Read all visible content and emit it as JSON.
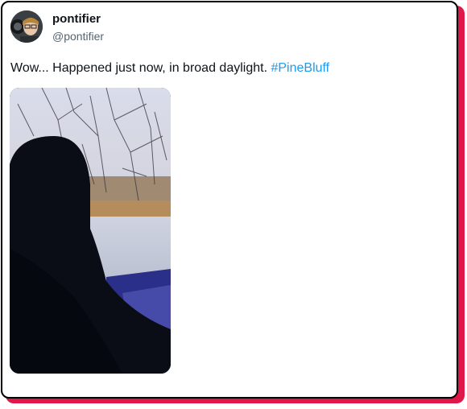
{
  "tweet": {
    "author": {
      "display_name": "pontifier",
      "handle": "@pontifier",
      "avatar_icon": "user-avatar-icon"
    },
    "text": "Wow... Happened just now, in broad daylight. ",
    "hashtag": "#PineBluff",
    "media_icon": "video-still-image"
  },
  "colors": {
    "card_border": "#000000",
    "card_shadow": "#e0184a",
    "link": "#1d9bf0",
    "text": "#0f1419",
    "muted": "#536471"
  }
}
